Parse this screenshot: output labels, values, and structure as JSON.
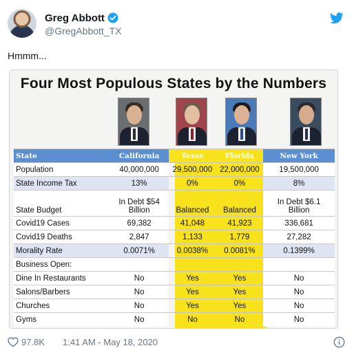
{
  "tweet": {
    "display_name": "Greg Abbott",
    "handle": "@GregAbbott_TX",
    "text": "Hmmm...",
    "likes": "97.8K",
    "timestamp": "1:41 AM - May 18, 2020",
    "accent_color": "#1da1f2"
  },
  "image": {
    "title": "Four Most Populous States by the Numbers",
    "highlight_color": "#f7e21c",
    "header_color": "#5b8fd1",
    "columns": [
      "State",
      "California",
      "Texas",
      "Florida",
      "New York"
    ],
    "rows": [
      {
        "label": "Population",
        "values": [
          "40,000,000",
          "29,500,000",
          "22,000,000",
          "19,500,000"
        ]
      },
      {
        "label": "State Income Tax",
        "values": [
          "13%",
          "0%",
          "0%",
          "8%"
        ]
      },
      {
        "label": "State Budget",
        "values": [
          "In Debt $54 Billion",
          "Balanced",
          "Balanced",
          "In Debt $6.1 Billion"
        ]
      },
      {
        "label": "Covid19 Cases",
        "values": [
          "69,382",
          "41,048",
          "41,923",
          "336,681"
        ]
      },
      {
        "label": "Covid19 Deaths",
        "values": [
          "2,847",
          "1,133",
          "1,779",
          "27,282"
        ]
      },
      {
        "label": "Morality Rate",
        "values": [
          "0.0071%",
          "0.0038%",
          "0.0081%",
          "0.1399%"
        ]
      },
      {
        "label": "Business Open:",
        "values": [
          "",
          "",
          "",
          ""
        ]
      },
      {
        "label": "Dine In Restaurants",
        "values": [
          "No",
          "Yes",
          "Yes",
          "No"
        ]
      },
      {
        "label": "Salons/Barbers",
        "values": [
          "No",
          "Yes",
          "Yes",
          "No"
        ]
      },
      {
        "label": "Churches",
        "values": [
          "No",
          "Yes",
          "Yes",
          "No"
        ]
      },
      {
        "label": "Gyms",
        "values": [
          "No",
          "No",
          "No",
          "No"
        ]
      }
    ],
    "budget_split": {
      "california": [
        "In Debt $54",
        "Billion"
      ],
      "new_york": [
        "In Debt $6.1",
        "Billion"
      ]
    }
  }
}
